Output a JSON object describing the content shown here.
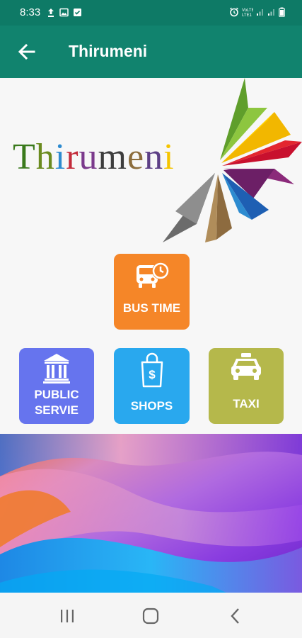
{
  "status_bar": {
    "time": "8:33",
    "left_icons": [
      "upload-icon",
      "image-icon",
      "check-square-icon"
    ],
    "right_icons": [
      "alarm-icon",
      "volte-icon",
      "signal-icon",
      "signal-icon",
      "battery-icon"
    ]
  },
  "app_bar": {
    "title": "Thirumeni",
    "back_icon": "arrow-left-icon"
  },
  "logo": {
    "letters": [
      {
        "ch": "T",
        "color": "#3a7a1c"
      },
      {
        "ch": "h",
        "color": "#6b8b1f"
      },
      {
        "ch": "i",
        "color": "#2d8bd0"
      },
      {
        "ch": "r",
        "color": "#c32b3a"
      },
      {
        "ch": "u",
        "color": "#7b3a8c"
      },
      {
        "ch": "m",
        "color": "#3d3d3d"
      },
      {
        "ch": "e",
        "color": "#8c6d3c"
      },
      {
        "ch": "n",
        "color": "#5d3f86"
      },
      {
        "ch": "i",
        "color": "#f5c400"
      }
    ]
  },
  "tiles": {
    "bus": {
      "label": "BUS TIME",
      "color": "#f58628"
    },
    "public": {
      "label_line1": "PUBLIC",
      "label_line2": "SERVIE",
      "color": "#6674ee"
    },
    "shops": {
      "label": "SHOPS",
      "color": "#29a8ee"
    },
    "taxi": {
      "label": "TAXI",
      "color": "#b5b84b"
    }
  },
  "nav": {
    "recents": "recents-icon",
    "home": "home-icon",
    "back": "back-icon"
  }
}
